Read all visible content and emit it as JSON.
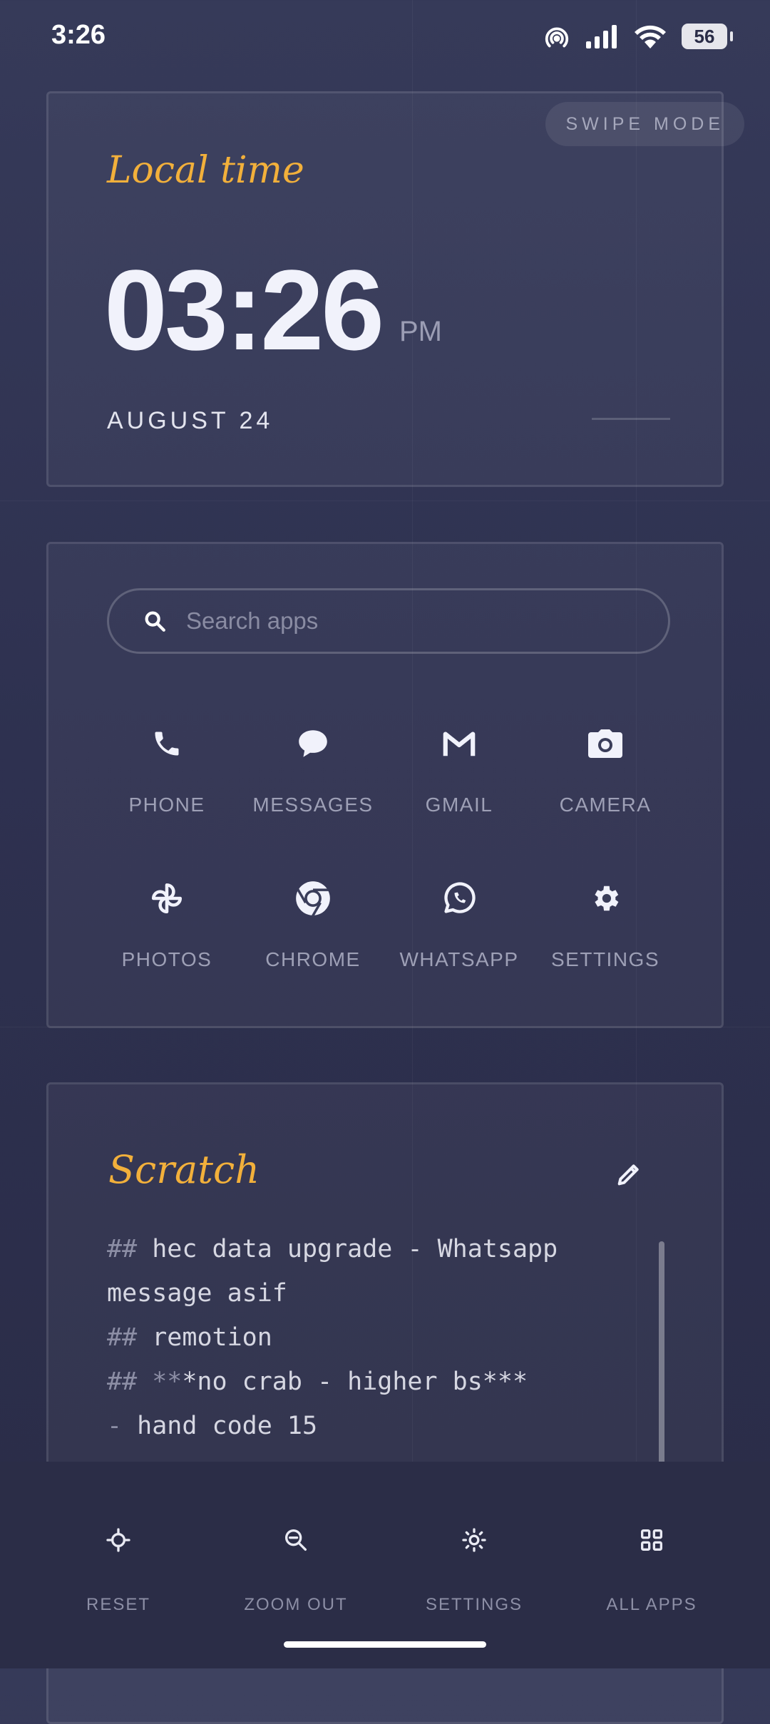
{
  "status_bar": {
    "time": "3:26",
    "battery": "56",
    "icons": [
      "hotspot-icon",
      "signal-icon",
      "wifi-icon",
      "battery-icon"
    ]
  },
  "clock_card": {
    "swipe_mode": "SWIPE MODE",
    "title": "Local time",
    "time": "03:26",
    "ampm": "PM",
    "date": "AUGUST 24"
  },
  "apps_card": {
    "search_placeholder": "Search apps",
    "apps": [
      {
        "label": "PHONE",
        "icon": "phone-icon"
      },
      {
        "label": "MESSAGES",
        "icon": "messages-icon"
      },
      {
        "label": "GMAIL",
        "icon": "gmail-icon"
      },
      {
        "label": "CAMERA",
        "icon": "camera-icon"
      },
      {
        "label": "PHOTOS",
        "icon": "photos-icon"
      },
      {
        "label": "CHROME",
        "icon": "chrome-icon"
      },
      {
        "label": "WHATSAPP",
        "icon": "whatsapp-icon"
      },
      {
        "label": "SETTINGS",
        "icon": "settings-icon"
      }
    ]
  },
  "scratch": {
    "title": "Scratch",
    "lines": [
      {
        "mark": "##",
        "text": " hec data upgrade - Whatsapp"
      },
      {
        "mark": "",
        "text": "message asif"
      },
      {
        "mark": "##",
        "text": " remotion"
      },
      {
        "mark": "## **",
        "text": "*no crab - higher bs***"
      },
      {
        "mark": "-",
        "text": " hand code 15"
      }
    ]
  },
  "bottom_nav": [
    {
      "label": "RESET",
      "icon": "crosshair-icon"
    },
    {
      "label": "ZOOM OUT",
      "icon": "zoom-out-icon"
    },
    {
      "label": "SETTINGS",
      "icon": "brightness-icon"
    },
    {
      "label": "ALL APPS",
      "icon": "grid-icon"
    }
  ],
  "colors": {
    "accent": "#f2b03b",
    "background": "#2e3150",
    "text": "#e9eaf3",
    "muted": "#9ea0b6"
  }
}
